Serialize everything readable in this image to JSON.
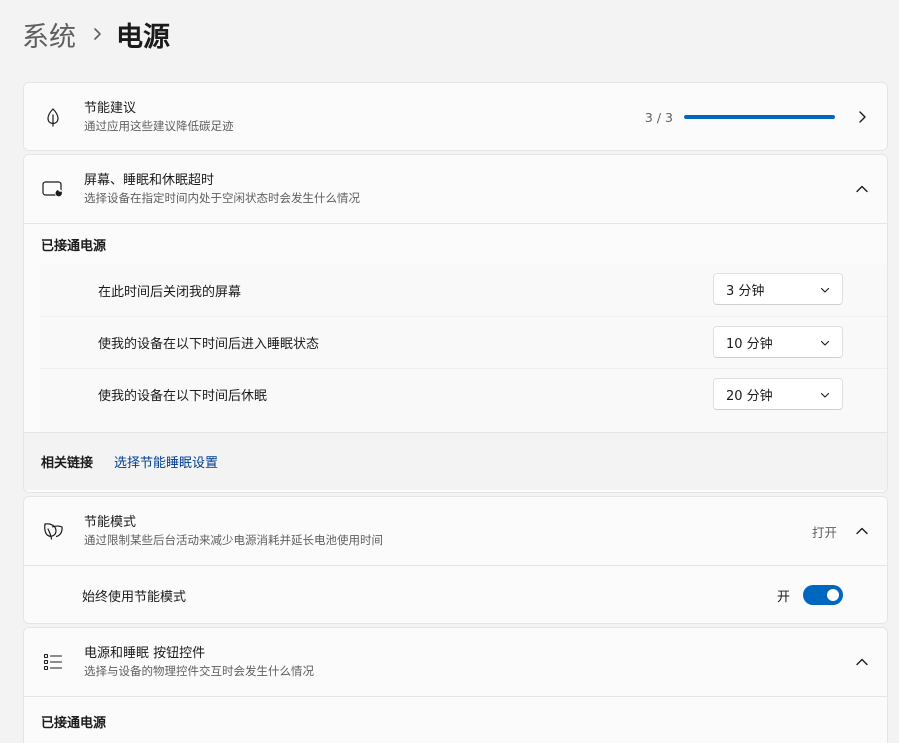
{
  "breadcrumb": {
    "parent": "系统",
    "current": "电源"
  },
  "energy_recommendations": {
    "title": "节能建议",
    "subtitle": "通过应用这些建议降低碳足迹",
    "progress_text": "3 / 3",
    "progress_fraction": 1.0,
    "icon": "leaf-icon"
  },
  "screen_sleep": {
    "title": "屏幕、睡眠和休眠超时",
    "subtitle": "选择设备在指定时间内处于空闲状态时会发生什么情况",
    "icon": "screen-sleep-icon",
    "section_label": "已接通电源",
    "rows": [
      {
        "label": "在此时间后关闭我的屏幕",
        "value": "3 分钟"
      },
      {
        "label": "使我的设备在以下时间后进入睡眠状态",
        "value": "10 分钟"
      },
      {
        "label": "使我的设备在以下时间后休眠",
        "value": "20 分钟"
      }
    ],
    "related_label": "相关链接",
    "related_link": "选择节能睡眠设置"
  },
  "energy_saver": {
    "title": "节能模式",
    "subtitle": "通过限制某些后台活动来减少电源消耗并延长电池使用时间",
    "status": "打开",
    "icon": "energy-saver-icon",
    "toggle_label": "始终使用节能模式",
    "toggle_state": "开",
    "toggle_on": true
  },
  "power_buttons": {
    "title": "电源和睡眠 按钮控件",
    "subtitle": "选择与设备的物理控件交互时会发生什么情况",
    "icon": "list-settings-icon",
    "section_label": "已接通电源"
  },
  "colors": {
    "accent": "#0067c0",
    "link": "#003e92"
  }
}
